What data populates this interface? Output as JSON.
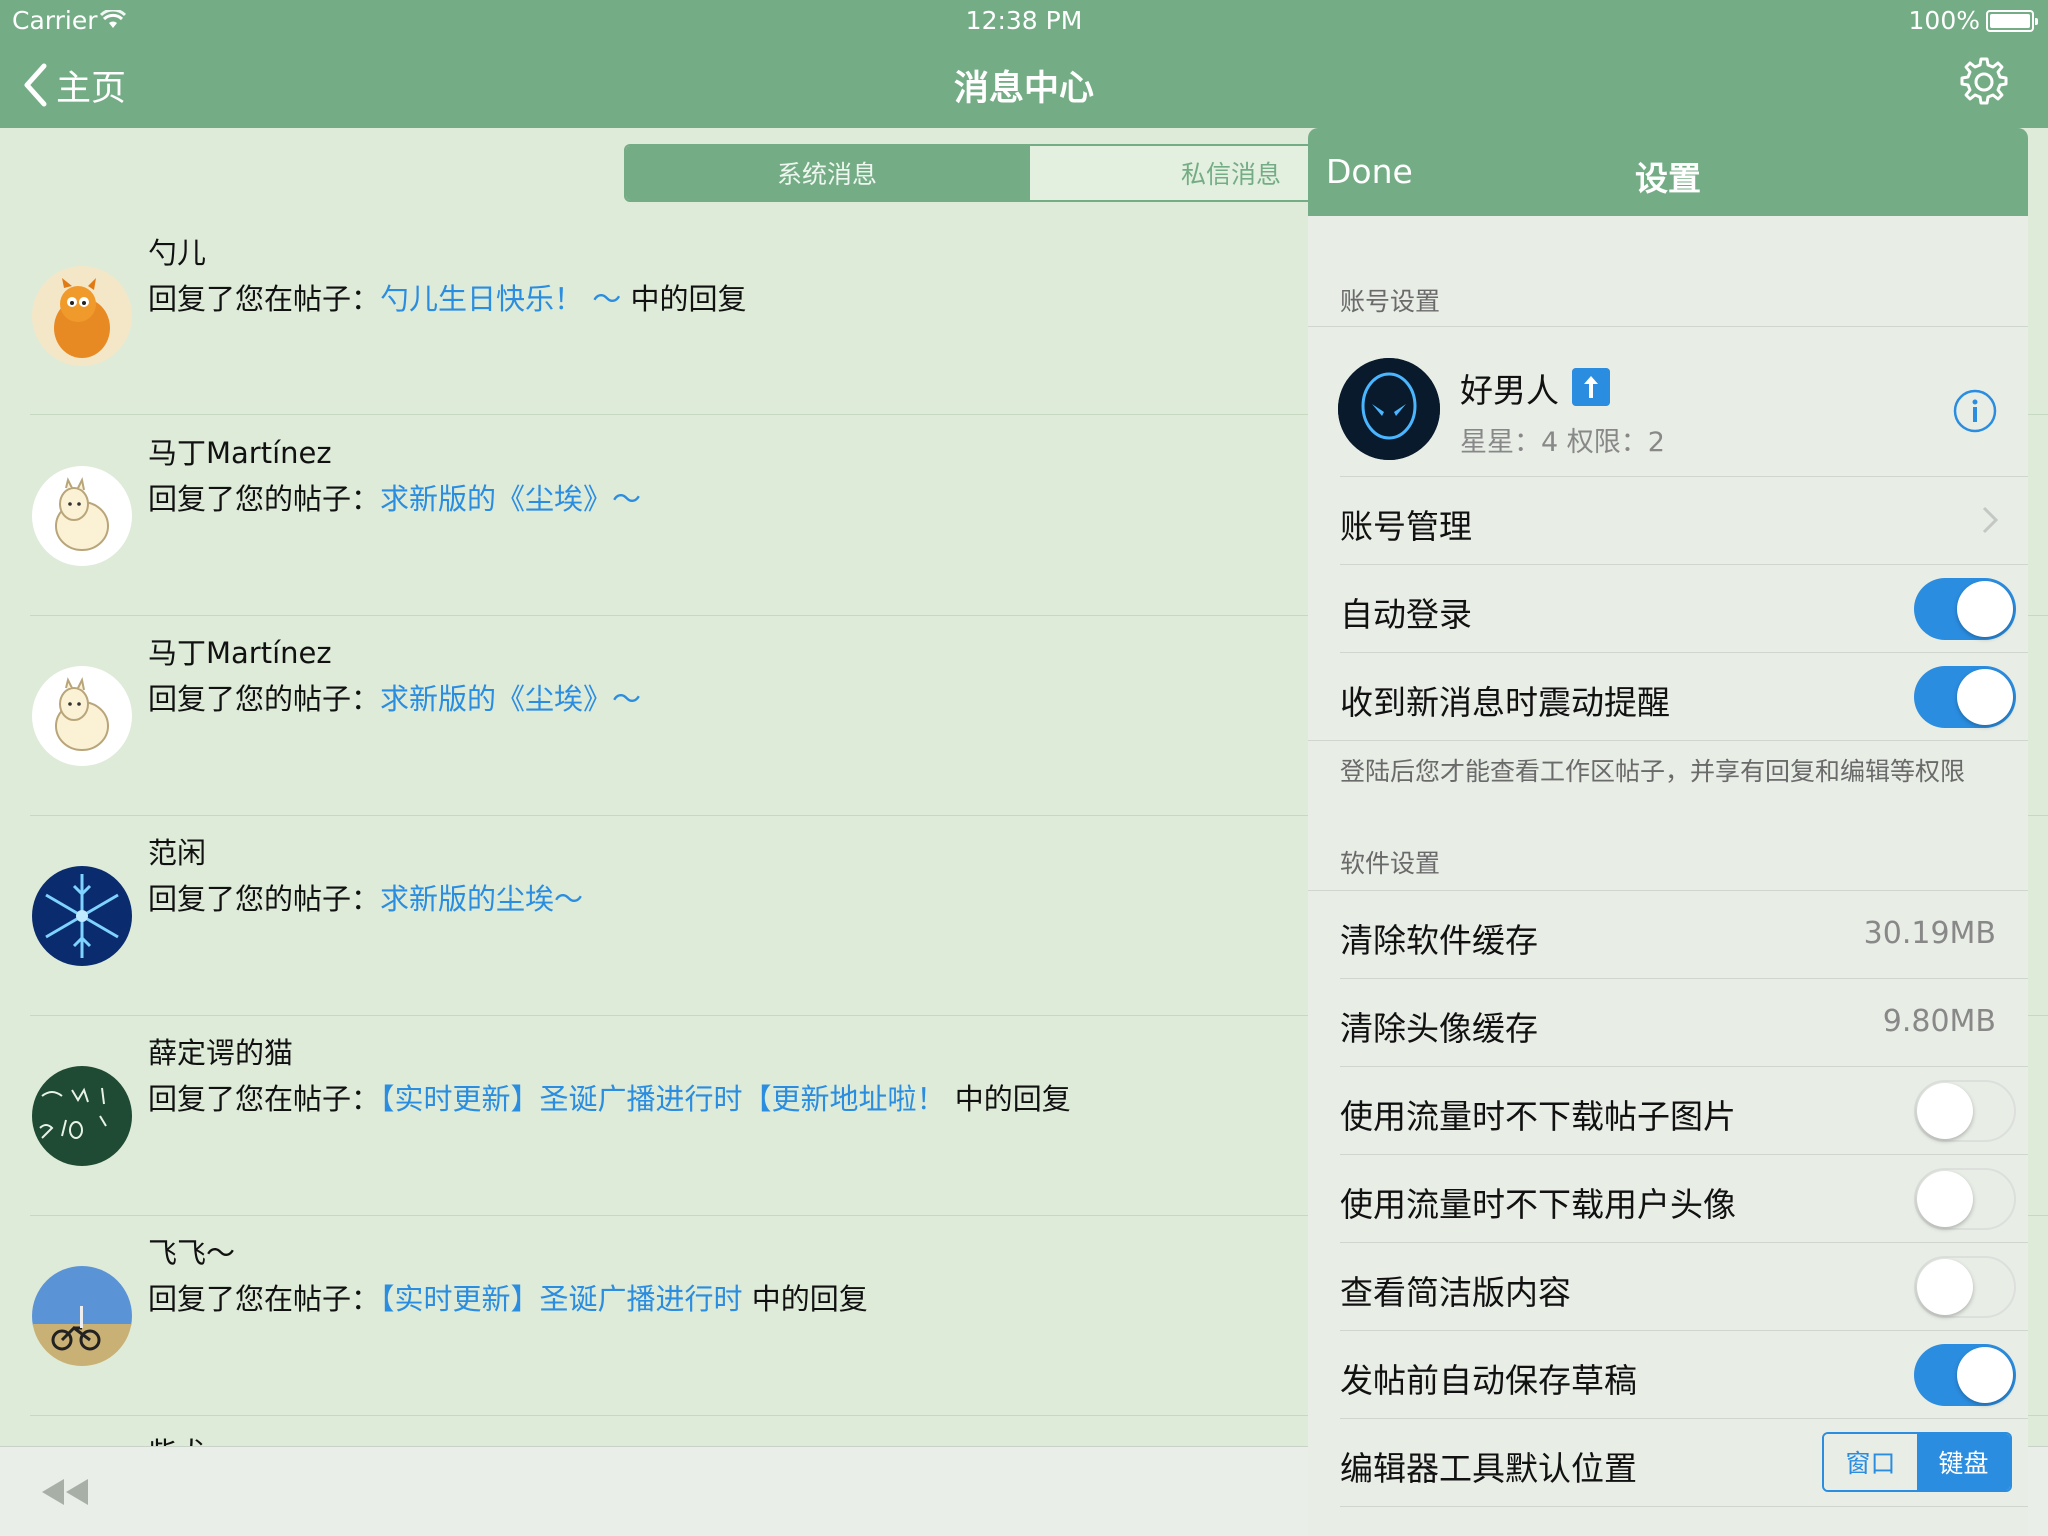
{
  "status": {
    "carrier": "Carrier",
    "time": "12:38 PM",
    "battery": "100%"
  },
  "nav": {
    "back_label": "主页",
    "title": "消息中心"
  },
  "tabs": [
    {
      "label": "系统消息",
      "active": true
    },
    {
      "label": "私信消息",
      "active": false
    }
  ],
  "messages": [
    {
      "name": "勺儿",
      "prefix": "回复了您在帖子：",
      "link": "勺儿生日快乐！ ～",
      "suffix": " 中的回复"
    },
    {
      "name": "马丁Martínez",
      "prefix": "回复了您的帖子：",
      "link": "求新版的《尘埃》～",
      "suffix": ""
    },
    {
      "name": "马丁Martínez",
      "prefix": "回复了您的帖子：",
      "link": "求新版的《尘埃》～",
      "suffix": ""
    },
    {
      "name": "范闲",
      "prefix": "回复了您的帖子：",
      "link": "求新版的尘埃～",
      "suffix": ""
    },
    {
      "name": "薛定谔的猫",
      "prefix": "回复了您在帖子：",
      "link": "【实时更新】圣诞广播进行时【更新地址啦！",
      "suffix": " 中的回复"
    },
    {
      "name": "飞飞～",
      "prefix": "回复了您在帖子：",
      "link": "【实时更新】圣诞广播进行时",
      "suffix": " 中的回复"
    },
    {
      "name": "柴犬",
      "prefix": "",
      "link": "",
      "suffix": ""
    }
  ],
  "settings": {
    "done_label": "Done",
    "title": "设置",
    "account_section": "账号设置",
    "profile": {
      "name": "好男人",
      "stats": "星星：4 权限：2"
    },
    "account_manage": "账号管理",
    "auto_login": {
      "label": "自动登录",
      "on": true
    },
    "vibrate": {
      "label": "收到新消息时震动提醒",
      "on": true
    },
    "login_hint": "登陆后您才能查看工作区帖子，并享有回复和编辑等权限",
    "software_section": "软件设置",
    "clear_cache": {
      "label": "清除软件缓存",
      "value": "30.19MB"
    },
    "clear_avatar": {
      "label": "清除头像缓存",
      "value": "9.80MB"
    },
    "no_post_images": {
      "label": "使用流量时不下载帖子图片",
      "on": false
    },
    "no_avatars": {
      "label": "使用流量时不下载用户头像",
      "on": false
    },
    "simple_view": {
      "label": "查看简洁版内容",
      "on": false
    },
    "autosave_draft": {
      "label": "发帖前自动保存草稿",
      "on": true
    },
    "editor_position": {
      "label": "编辑器工具默认位置",
      "options": [
        "窗口",
        "键盘"
      ],
      "selected": "键盘"
    }
  },
  "colors": {
    "nav_green": "#74ad85",
    "background": "#deebd9",
    "link_blue": "#2b8de0"
  }
}
